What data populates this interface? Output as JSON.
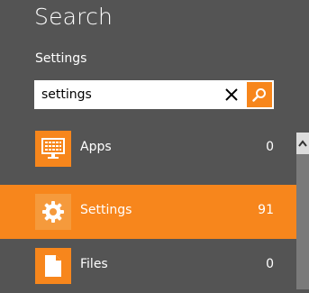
{
  "header": {
    "title": "Search",
    "scope": "Settings"
  },
  "search": {
    "value": "settings"
  },
  "results": [
    {
      "label": "Apps",
      "count": "0",
      "icon": "apps-icon",
      "selected": false
    },
    {
      "label": "Settings",
      "count": "91",
      "icon": "gear-icon",
      "selected": true
    },
    {
      "label": "Files",
      "count": "0",
      "icon": "file-icon",
      "selected": false
    }
  ],
  "colors": {
    "background": "#545454",
    "accent": "#f7861c",
    "text": "#ffffff"
  }
}
